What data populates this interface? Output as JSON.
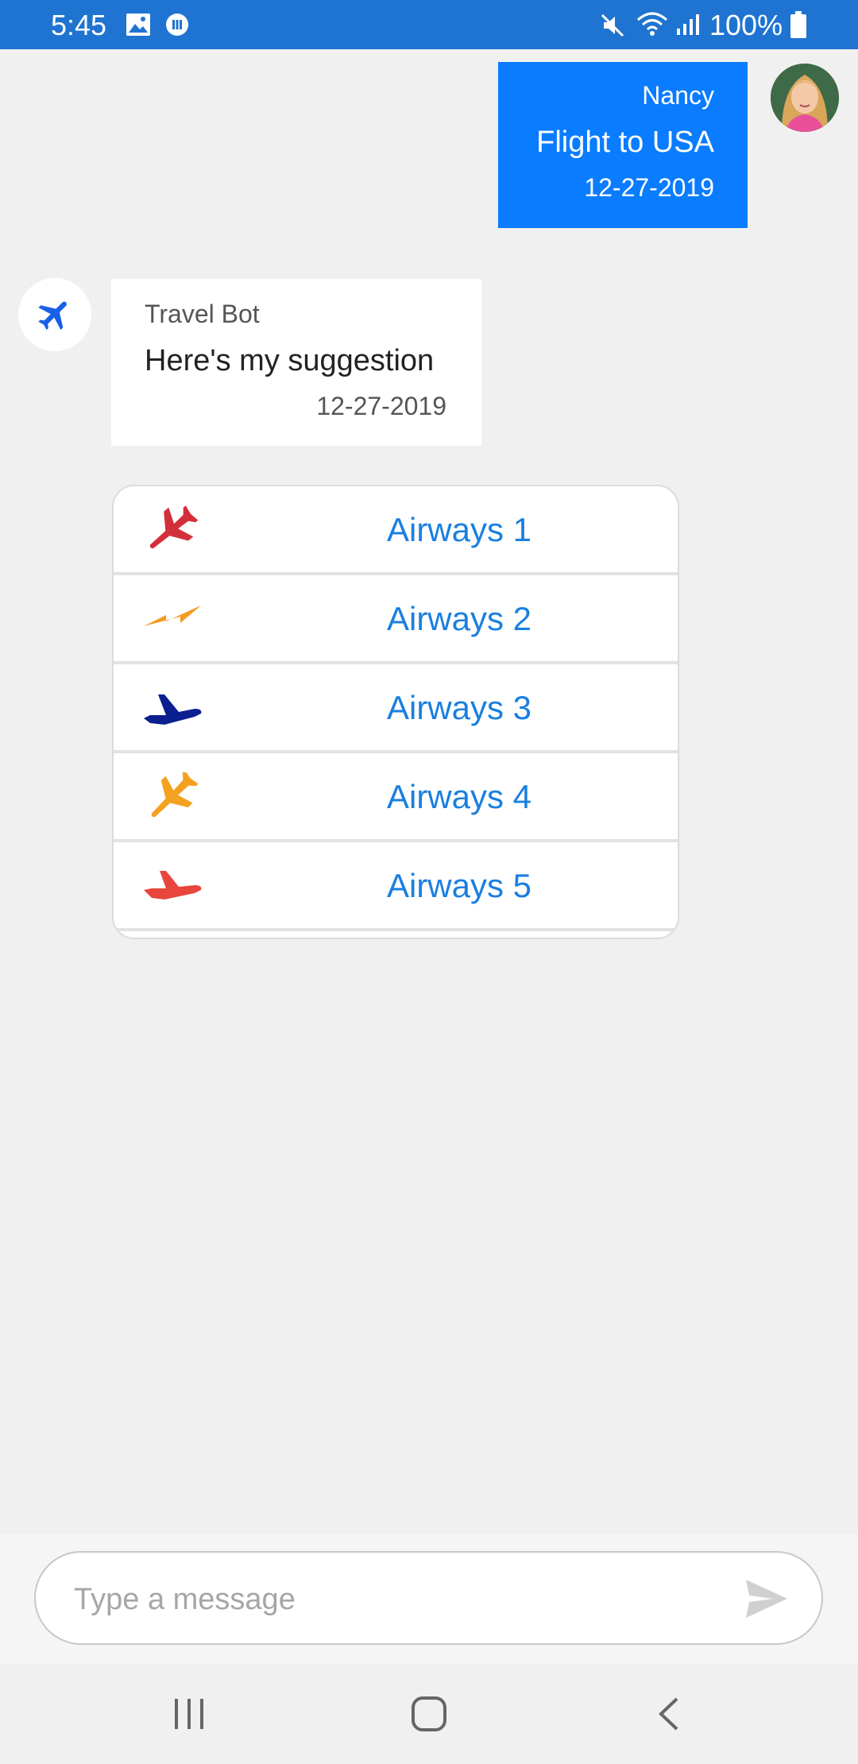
{
  "status_bar": {
    "time": "5:45",
    "battery_text": "100%",
    "icons": [
      "image-icon",
      "app-notification-icon",
      "mute-icon",
      "wifi-icon",
      "signal-icon",
      "battery-icon"
    ]
  },
  "outgoing_message": {
    "sender": "Nancy",
    "text": "Flight to USA",
    "date": "12-27-2019",
    "bubble_color": "#0a7cff"
  },
  "bot_message": {
    "sender": "Travel Bot",
    "text": "Here's my suggestion",
    "date": "12-27-2019",
    "avatar_icon": "airplane-icon"
  },
  "airways": [
    {
      "label": "Airways 1",
      "icon": "red-airplane-logo",
      "color": "#d32f3a"
    },
    {
      "label": "Airways 2",
      "icon": "orange-bolt-logo",
      "color": "#f49a1f"
    },
    {
      "label": "Airways 3",
      "icon": "navy-airplane-logo",
      "color": "#0b1f8f"
    },
    {
      "label": "Airways 4",
      "icon": "orange-airplane-logo",
      "color": "#f4a11f"
    },
    {
      "label": "Airways 5",
      "icon": "red-jet-logo",
      "color": "#e8453c"
    }
  ],
  "composer": {
    "placeholder": "Type a message",
    "send_icon": "send-icon"
  },
  "nav_bar": {
    "buttons": [
      "recent-apps-icon",
      "home-icon",
      "back-icon"
    ]
  },
  "colors": {
    "status_bar": "#1f74d1",
    "link": "#1a7fe0",
    "background": "#f0f0f0"
  }
}
